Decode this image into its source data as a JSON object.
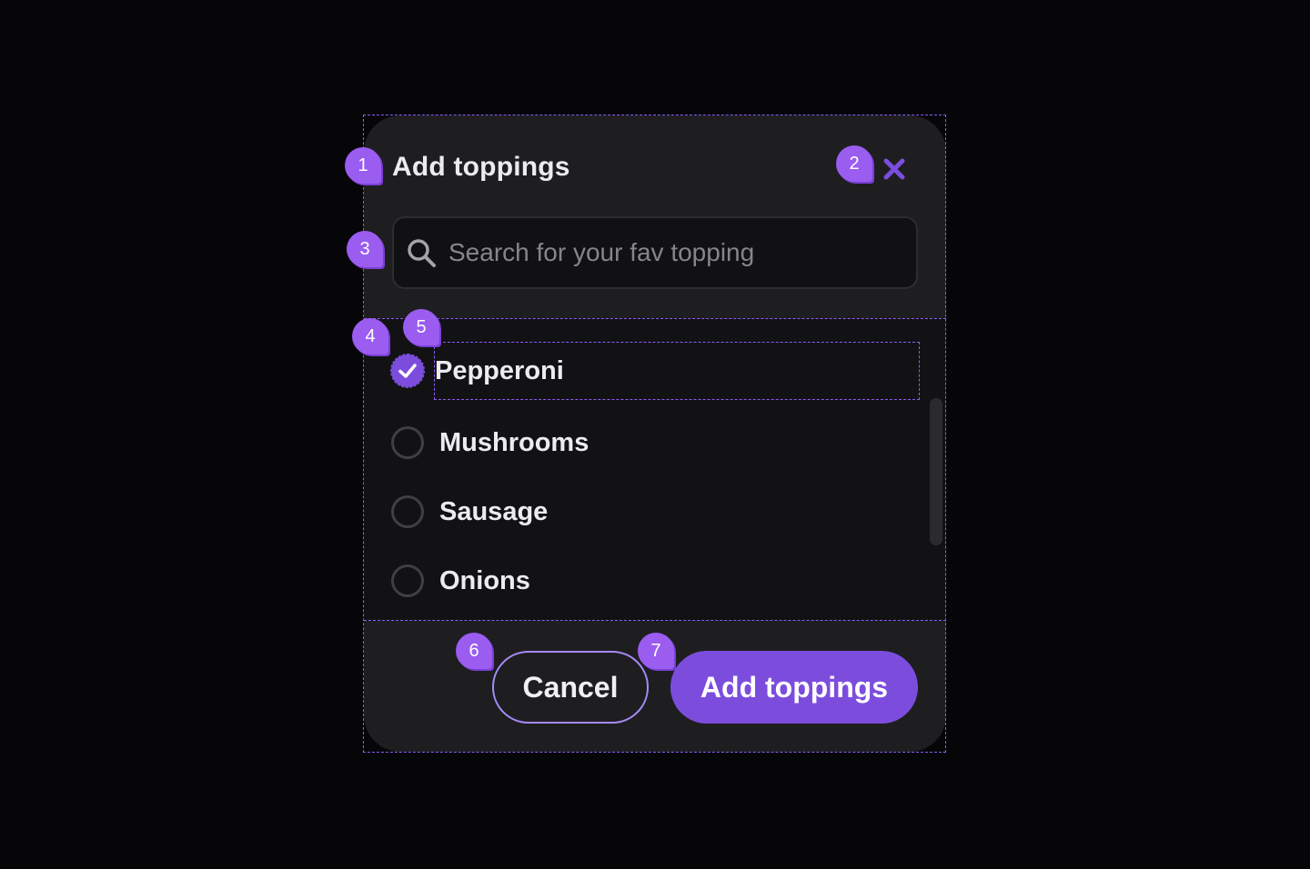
{
  "dialog": {
    "title": "Add toppings",
    "close_icon": "close-icon",
    "search": {
      "placeholder": "Search for your fav topping",
      "value": "",
      "icon": "search-icon"
    },
    "toppings": [
      {
        "label": "Pepperoni",
        "checked": true
      },
      {
        "label": "Mushrooms",
        "checked": false
      },
      {
        "label": "Sausage",
        "checked": false
      },
      {
        "label": "Onions",
        "checked": false
      }
    ],
    "actions": {
      "cancel_label": "Cancel",
      "submit_label": "Add toppings"
    }
  },
  "annotations": {
    "badge_1": "1",
    "badge_2": "2",
    "badge_3": "3",
    "badge_4": "4",
    "badge_5": "5",
    "badge_6": "6",
    "badge_7": "7"
  },
  "colors": {
    "accent": "#7c4ddd",
    "accent_light": "#a78bfa",
    "badge": "#9b5cf0",
    "dialog_bg": "#1e1e21",
    "page_bg": "#060608"
  }
}
